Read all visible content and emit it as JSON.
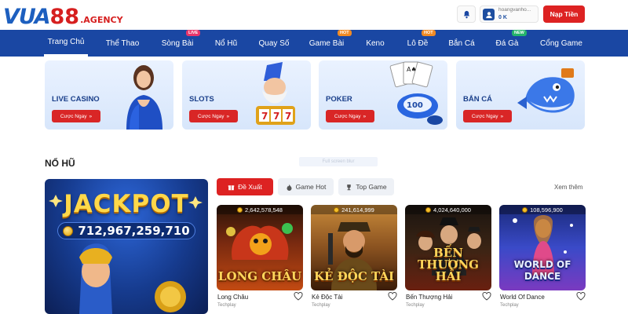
{
  "header": {
    "logo_main": "VUA",
    "logo_number": "88",
    "logo_suffix": ".AGENCY",
    "username": "hoangvanho...",
    "balance": "0 K",
    "deposit_label": "Nạp Tiền"
  },
  "nav": {
    "items": [
      {
        "label": "Trang Chủ",
        "badge": ""
      },
      {
        "label": "Thể Thao",
        "badge": ""
      },
      {
        "label": "Sòng Bài",
        "badge": "LIVE"
      },
      {
        "label": "Nổ Hũ",
        "badge": ""
      },
      {
        "label": "Quay Số",
        "badge": ""
      },
      {
        "label": "Game Bài",
        "badge": "HOT"
      },
      {
        "label": "Keno",
        "badge": ""
      },
      {
        "label": "Lô Đề",
        "badge": "HOT"
      },
      {
        "label": "Bắn Cá",
        "badge": ""
      },
      {
        "label": "Đá Gà",
        "badge": "NEW"
      },
      {
        "label": "Cổng Game",
        "badge": ""
      }
    ]
  },
  "banners": [
    {
      "title": "LIVE CASINO",
      "button": "Cược Ngay"
    },
    {
      "title": "SLOTS",
      "button": "Cược Ngay"
    },
    {
      "title": "POKER",
      "button": "Cược Ngay"
    },
    {
      "title": "BẮN CÁ",
      "button": "Cược Ngay"
    }
  ],
  "section": {
    "title": "NỔ HŨ",
    "ghost_text": "Full screen blur"
  },
  "jackpot": {
    "title": "JACKPOT",
    "value": "712,967,259,710"
  },
  "tabs": [
    {
      "label": "Đề Xuất",
      "active": true
    },
    {
      "label": "Game Hot",
      "active": false
    },
    {
      "label": "Top Game",
      "active": false
    }
  ],
  "see_more": "Xem thêm",
  "games": [
    {
      "count": "2,642,578,548",
      "art_title": "LONG CHÂU",
      "name": "Long Châu",
      "provider": "Techplay"
    },
    {
      "count": "241,614,999",
      "art_title": "KẺ ĐỘC TÀI",
      "name": "Kẻ Độc Tài",
      "provider": "Techplay"
    },
    {
      "count": "4,024,640,000",
      "art_title": "BẾN THƯỢNG HẢI",
      "name": "Bến Thượng Hải",
      "provider": "Techplay"
    },
    {
      "count": "108,596,900",
      "art_title": "WORLD OF DANCE",
      "name": "World Of Dance",
      "provider": "Techplay"
    }
  ],
  "colors": {
    "brand_blue": "#1a47a3",
    "accent_red": "#dd2222",
    "badge_live": "#e8356b",
    "badge_hot": "#f08a24",
    "badge_new": "#24b36b"
  }
}
